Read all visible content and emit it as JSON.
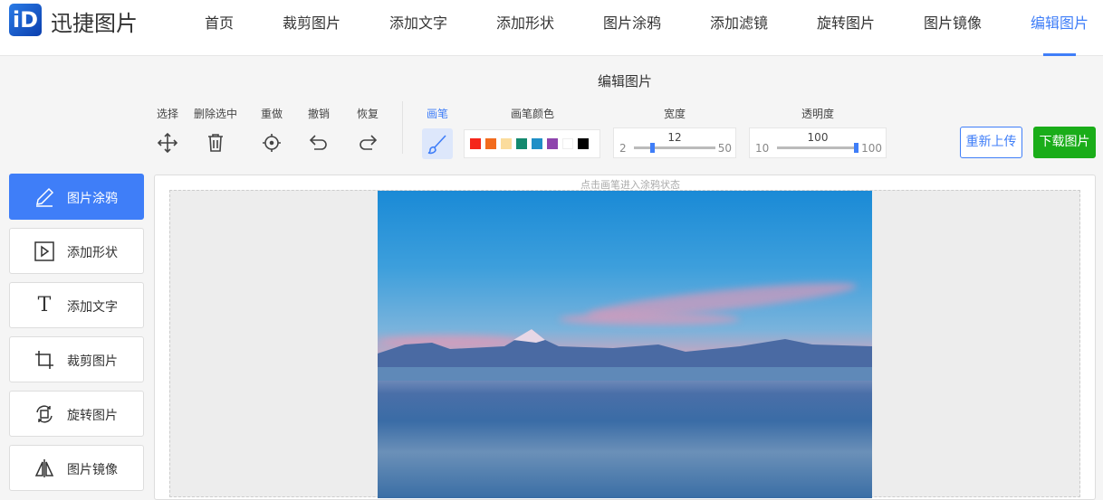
{
  "header": {
    "logo_text": "iD",
    "brand": "迅捷图片",
    "nav": [
      "首页",
      "裁剪图片",
      "添加文字",
      "添加形状",
      "图片涂鸦",
      "添加滤镜",
      "旋转图片",
      "图片镜像",
      "编辑图片"
    ],
    "active_nav": "编辑图片"
  },
  "page_title": "编辑图片",
  "toolbar": {
    "select": "选择",
    "delete_selected": "删除选中",
    "redo_center": "重做",
    "undo": "撤销",
    "restore": "恢复",
    "pen": "画笔",
    "pen_color": "画笔颜色",
    "width_label": "宽度",
    "width": {
      "value": "12",
      "min": "2",
      "max": "50"
    },
    "opacity_label": "透明度",
    "opacity": {
      "value": "100",
      "min": "10",
      "max": "100"
    },
    "colors": [
      "#f5261b",
      "#f26b1d",
      "#fbdc9c",
      "#13896e",
      "#1f8fc7",
      "#8e44ad",
      "#ffffff",
      "#000000"
    ],
    "reupload": "重新上传",
    "download": "下载图片"
  },
  "sidebar": [
    {
      "label": "图片涂鸦",
      "icon": "pen-icon"
    },
    {
      "label": "添加形状",
      "icon": "shape-icon"
    },
    {
      "label": "添加文字",
      "icon": "text-icon"
    },
    {
      "label": "裁剪图片",
      "icon": "crop-icon"
    },
    {
      "label": "旋转图片",
      "icon": "rotate-icon"
    },
    {
      "label": "图片镜像",
      "icon": "mirror-icon"
    }
  ],
  "canvas": {
    "hint": "点击画笔进入涂鸦状态"
  },
  "colors": {
    "accent": "#3f7ef8",
    "download": "#1aad19"
  }
}
